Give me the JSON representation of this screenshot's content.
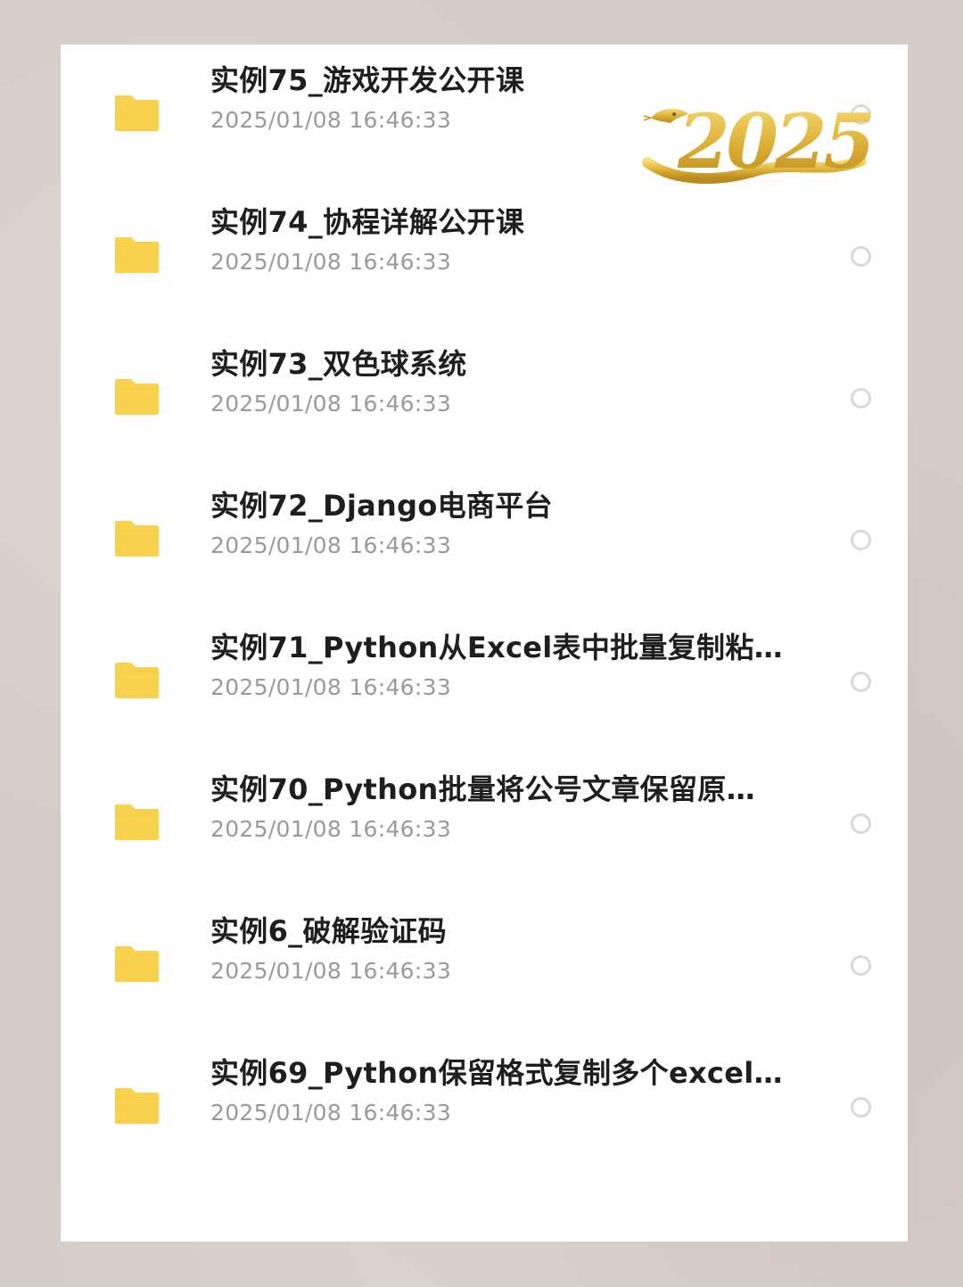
{
  "colors": {
    "background": "#d6ccc7",
    "panel": "#ffffff",
    "folder": "#f8d24f",
    "title_text": "#1e1e1e",
    "date_text": "#9a9a9a",
    "radio_border": "#d9d9d9",
    "badge_gold": "#d9a92e"
  },
  "decoration": {
    "badge_text": "2025",
    "badge_icon": "snake-2025-logo-icon"
  },
  "files": {
    "items": [
      {
        "name": "实例75_游戏开发公开课",
        "modified": "2025/01/08 16:46:33",
        "icon": "folder-icon",
        "selected": false
      },
      {
        "name": "实例74_协程详解公开课",
        "modified": "2025/01/08 16:46:33",
        "icon": "folder-icon",
        "selected": false
      },
      {
        "name": "实例73_双色球系统",
        "modified": "2025/01/08 16:46:33",
        "icon": "folder-icon",
        "selected": false
      },
      {
        "name": "实例72_Django电商平台",
        "modified": "2025/01/08 16:46:33",
        "icon": "folder-icon",
        "selected": false
      },
      {
        "name": "实例71_Python从Excel表中批量复制粘…",
        "modified": "2025/01/08 16:46:33",
        "icon": "folder-icon",
        "selected": false
      },
      {
        "name": "实例70_Python批量将公号文章保留原…",
        "modified": "2025/01/08 16:46:33",
        "icon": "folder-icon",
        "selected": false
      },
      {
        "name": "实例6_破解验证码",
        "modified": "2025/01/08 16:46:33",
        "icon": "folder-icon",
        "selected": false
      },
      {
        "name": "实例69_Python保留格式复制多个excel…",
        "modified": "2025/01/08 16:46:33",
        "icon": "folder-icon",
        "selected": false
      }
    ]
  }
}
